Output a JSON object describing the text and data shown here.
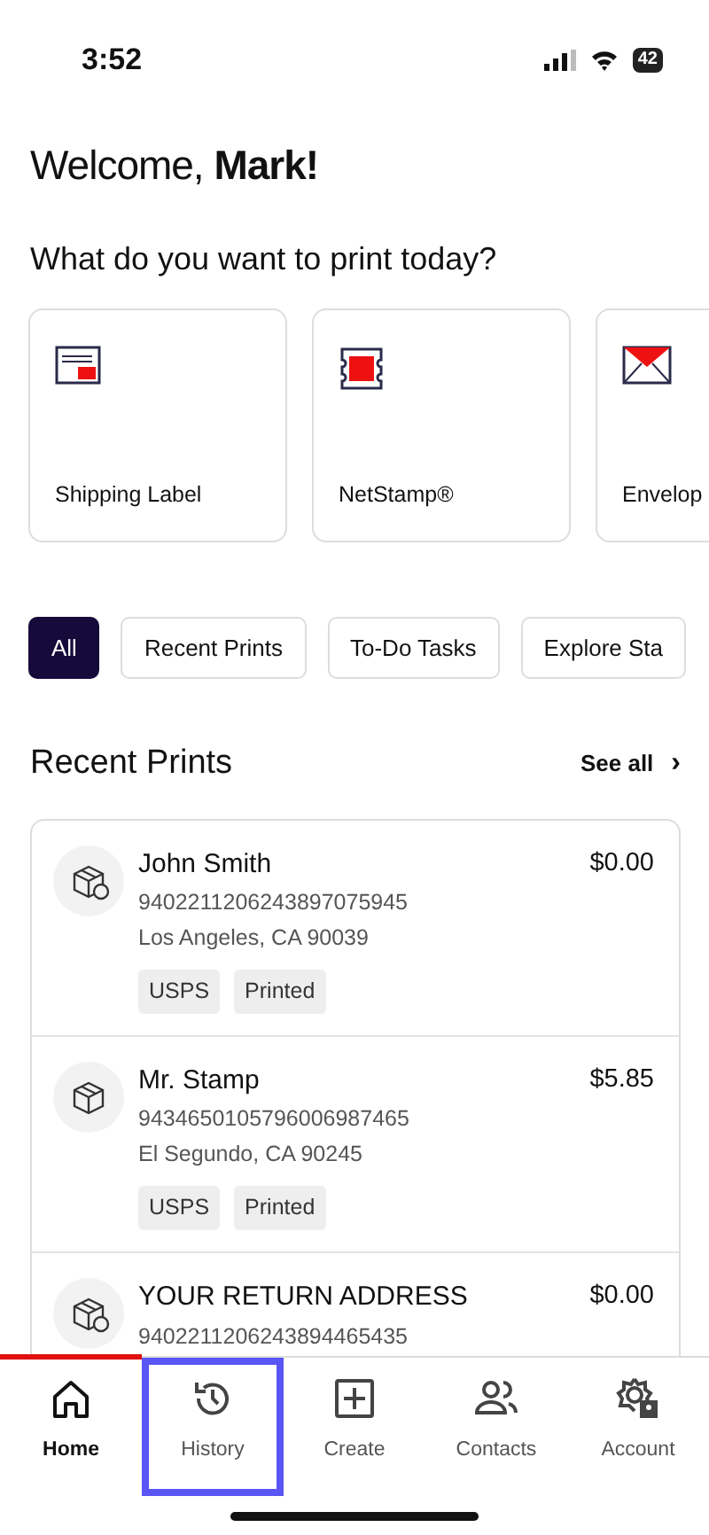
{
  "status_bar": {
    "time": "3:52",
    "battery": "42"
  },
  "greeting": {
    "text": "Welcome,",
    "name": "Mark!"
  },
  "prompt": "What do you want to print today?",
  "print_options": [
    {
      "label": "Shipping Label",
      "kind": "label"
    },
    {
      "label": "NetStamp®",
      "kind": "stamp"
    },
    {
      "label": "Envelop",
      "kind": "envelope"
    }
  ],
  "filters": [
    {
      "label": "All",
      "selected": true
    },
    {
      "label": "Recent Prints",
      "selected": false
    },
    {
      "label": "To-Do Tasks",
      "selected": false
    },
    {
      "label": "Explore Sta",
      "selected": false
    }
  ],
  "recent_prints": {
    "title": "Recent Prints",
    "see_all": "See all",
    "chevron": "›",
    "items": [
      {
        "kind": "return",
        "name": "John Smith",
        "tracking": "9402211206243897075945",
        "location": "Los Angeles, CA 90039",
        "amount": "$0.00",
        "tags": [
          "USPS",
          "Printed"
        ]
      },
      {
        "kind": "box",
        "name": "Mr. Stamp",
        "tracking": "9434650105796006987465",
        "location": "El Segundo, CA 90245",
        "amount": "$5.85",
        "tags": [
          "USPS",
          "Printed"
        ]
      },
      {
        "kind": "return",
        "name": "YOUR RETURN ADDRESS",
        "tracking": "9402211206243894465435",
        "amount": "$0.00"
      }
    ]
  },
  "tab_bar": [
    {
      "label": "Home",
      "kind": "home",
      "selected": true,
      "focused": false
    },
    {
      "label": "History",
      "kind": "history",
      "selected": false,
      "focused": true
    },
    {
      "label": "Create",
      "kind": "create",
      "selected": false,
      "focused": false
    },
    {
      "label": "Contacts",
      "kind": "contacts",
      "selected": false,
      "focused": false
    },
    {
      "label": "Account",
      "kind": "account",
      "selected": false,
      "focused": false
    }
  ]
}
